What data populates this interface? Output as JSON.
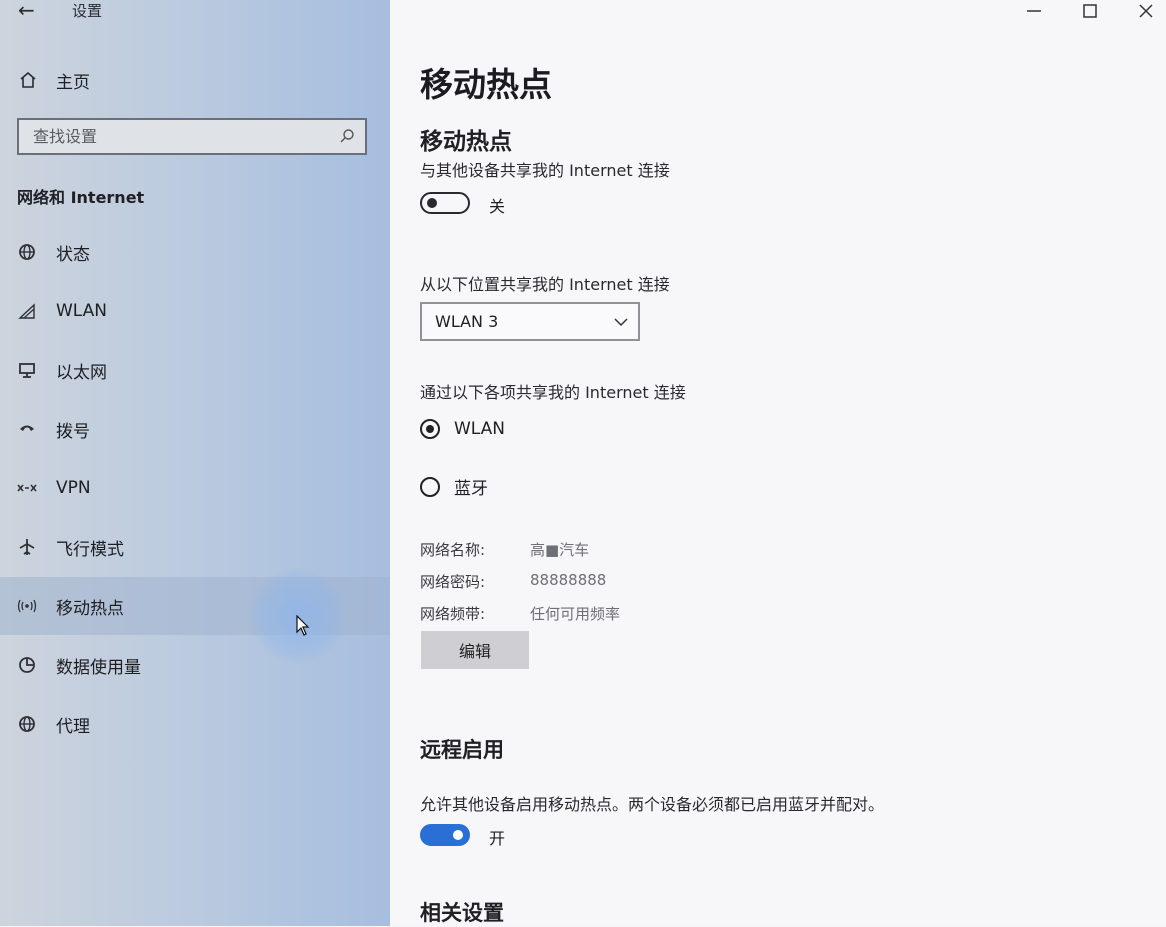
{
  "window": {
    "title": "设置",
    "back_icon": "←"
  },
  "sidebar": {
    "home": "主页",
    "search_placeholder": "查找设置",
    "section": "网络和 Internet",
    "items": [
      {
        "label": "状态",
        "icon": "globe-icon"
      },
      {
        "label": "WLAN",
        "icon": "wifi-icon"
      },
      {
        "label": "以太网",
        "icon": "ethernet-icon"
      },
      {
        "label": "拨号",
        "icon": "dialup-icon"
      },
      {
        "label": "VPN",
        "icon": "vpn-icon"
      },
      {
        "label": "飞行模式",
        "icon": "airplane-icon"
      },
      {
        "label": "移动热点",
        "icon": "hotspot-icon",
        "active": true
      },
      {
        "label": "数据使用量",
        "icon": "data-usage-icon"
      },
      {
        "label": "代理",
        "icon": "proxy-icon"
      }
    ]
  },
  "main": {
    "title": "移动热点",
    "hotspot": {
      "heading": "移动热点",
      "share_desc": "与其他设备共享我的 Internet 连接",
      "toggle_state": "关",
      "source_label": "从以下位置共享我的 Internet 连接",
      "source_value": "WLAN 3",
      "via_label": "通过以下各项共享我的 Internet 连接",
      "options": [
        {
          "label": "WLAN",
          "checked": true
        },
        {
          "label": "蓝牙",
          "checked": false
        }
      ],
      "network_name_label": "网络名称:",
      "network_name_value": "高■汽车",
      "password_label": "网络密码:",
      "password_value": "88888888",
      "band_label": "网络频带:",
      "band_value": "任何可用频率",
      "edit_button": "编辑"
    },
    "remote": {
      "heading": "远程启用",
      "desc": "允许其他设备启用移动热点。两个设备必须都已启用蓝牙并配对。",
      "toggle_state": "开"
    },
    "related_heading": "相关设置"
  },
  "colors": {
    "accent": "#2a6fd6",
    "sidebar": "#bccbdf"
  }
}
